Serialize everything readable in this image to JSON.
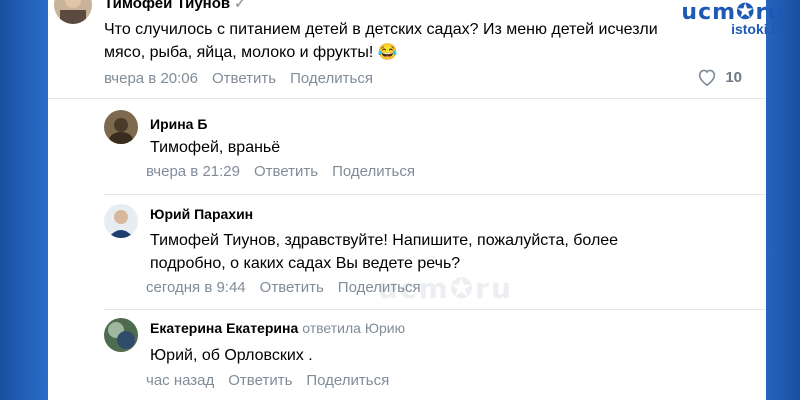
{
  "watermark": {
    "logo": "ucm✪ru",
    "site": "istoki.tv",
    "overlay": "ucm✪ru"
  },
  "comments": [
    {
      "author": "Тимофей Тиунов",
      "verified": "✓",
      "text_line1": "Что случилось с питанием детей в детских садах? Из меню детей исчезли",
      "text_line2": "мясо, рыба, яйца, молоко и фрукты! 😂",
      "time": "вчера в 20:06",
      "reply": "Ответить",
      "share": "Поделиться",
      "likes": "10"
    },
    {
      "author": "Ирина Б",
      "text_line1": "Тимофей, враньё",
      "time": "вчера в 21:29",
      "reply": "Ответить",
      "share": "Поделиться"
    },
    {
      "author": "Юрий Парахин",
      "text_line1": "Тимофей Тиунов, здравствуйте! Напишите, пожалуйста, более",
      "text_line2": "подробно, о каких садах Вы ведете речь?",
      "time": "сегодня в 9:44",
      "reply": "Ответить",
      "share": "Поделиться"
    },
    {
      "author": "Екатерина Екатерина",
      "reply_to": "ответила Юрию",
      "text_line1": "Юрий, об Орловских .",
      "time": "час назад",
      "reply": "Ответить",
      "share": "Поделиться"
    }
  ],
  "colors": {
    "accent": "#1d5bb5",
    "secondary_text": "#818c99",
    "divider": "#e4e6ea"
  },
  "icons": {
    "like": "heart-icon"
  }
}
